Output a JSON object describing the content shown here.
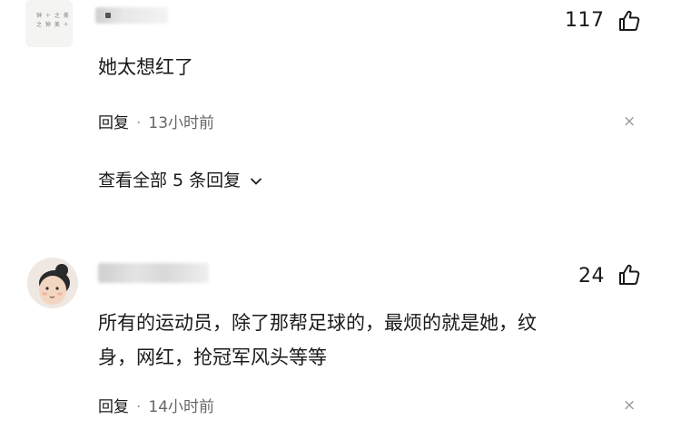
{
  "comments": [
    {
      "likes": "117",
      "text": "她太想红了",
      "reply_label": "回复",
      "separator": "·",
      "time": "13小时前",
      "close": "×",
      "view_all": "查看全部 5 条回复"
    },
    {
      "likes": "24",
      "text_line1": "所有的运动员，除了那帮足球的，最烦的就是她，纹",
      "text_line2": "身，网红，抢冠军风头等等",
      "reply_label": "回复",
      "separator": "·",
      "time": "14小时前",
      "close": "×"
    }
  ]
}
